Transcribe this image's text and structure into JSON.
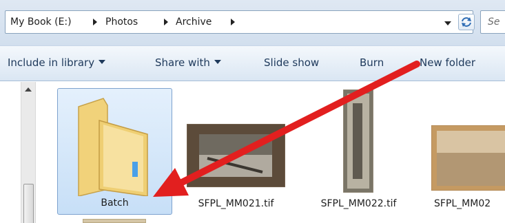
{
  "address_bar": {
    "breadcrumbs": [
      "My Book (E:)",
      "Photos",
      "Archive"
    ]
  },
  "search": {
    "placeholder": "Se"
  },
  "toolbar": {
    "include_in_library": "Include in library",
    "share_with": "Share with",
    "slide_show": "Slide show",
    "burn": "Burn",
    "new_folder": "New folder"
  },
  "files": [
    {
      "name": "Batch",
      "type": "folder",
      "selected": true
    },
    {
      "name": "SFPL_MM021.tif",
      "type": "image"
    },
    {
      "name": "SFPL_MM022.tif",
      "type": "image"
    },
    {
      "name": "SFPL_MM02",
      "type": "image"
    }
  ],
  "colors": {
    "selection_fill": "#cce1f7",
    "toolbar_text": "#1e395b",
    "annotation_arrow": "#e21f1f"
  },
  "icons": [
    "chevron-right-icon",
    "dropdown-caret-icon",
    "refresh-icon",
    "folder-icon",
    "scroll-up-icon",
    "red-arrow-annotation"
  ]
}
